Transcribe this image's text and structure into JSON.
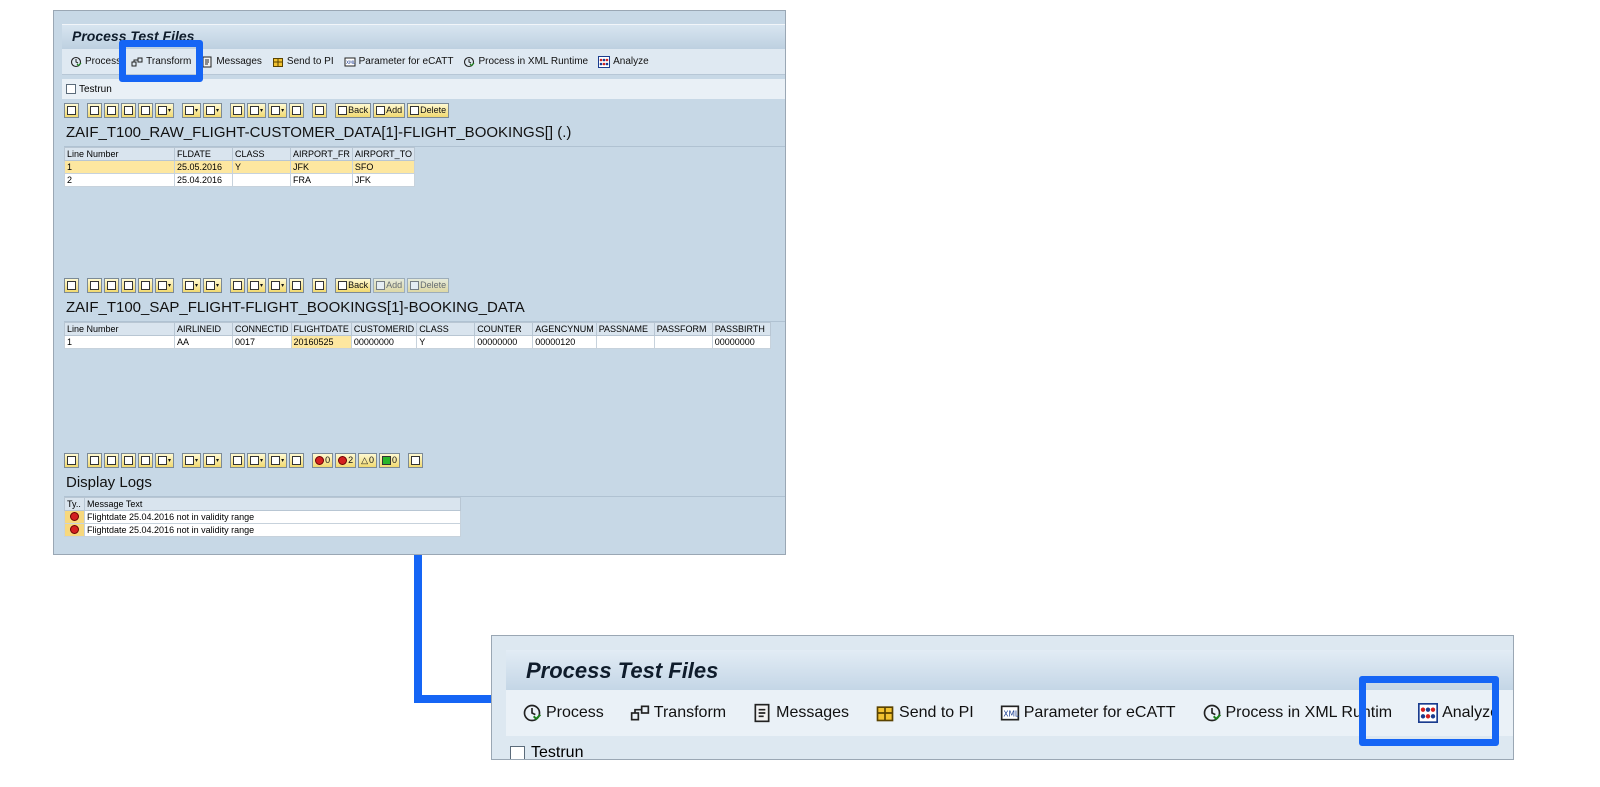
{
  "window": {
    "title": "Process Test Files"
  },
  "toolbar": {
    "items": [
      {
        "label": "Process",
        "icon": "clock-check-icon"
      },
      {
        "label": "Transform",
        "icon": "transform-icon"
      },
      {
        "label": "Messages",
        "icon": "messages-icon"
      },
      {
        "label": "Send to PI",
        "icon": "package-icon"
      },
      {
        "label": "Parameter for eCATT",
        "icon": "parameter-icon"
      },
      {
        "label": "Process in XML Runtime",
        "icon": "clock-check-icon"
      },
      {
        "label": "Analyze",
        "icon": "analyze-icon"
      }
    ]
  },
  "testrun": {
    "label": "Testrun",
    "checked": false
  },
  "grid1": {
    "toolbar": {
      "back": "Back",
      "add": "Add",
      "delete": "Delete"
    },
    "title": "ZAIF_T100_RAW_FLIGHT-CUSTOMER_DATA[1]-FLIGHT_BOOKINGS[] (.)",
    "columns": [
      "Line Number",
      "FLDATE",
      "CLASS",
      "AIRPORT_FR",
      "AIRPORT_TO"
    ],
    "rows": [
      [
        "1",
        "25.05.2016",
        "Y",
        "JFK",
        "SFO"
      ],
      [
        "2",
        "25.04.2016",
        "",
        "FRA",
        "JFK"
      ]
    ]
  },
  "grid2": {
    "toolbar": {
      "back": "Back",
      "add": "Add",
      "delete": "Delete"
    },
    "title": "ZAIF_T100_SAP_FLIGHT-FLIGHT_BOOKINGS[1]-BOOKING_DATA",
    "columns": [
      "Line Number",
      "AIRLINEID",
      "CONNECTID",
      "FLIGHTDATE",
      "CUSTOMERID",
      "CLASS",
      "COUNTER",
      "AGENCYNUM",
      "PASSNAME",
      "PASSFORM",
      "PASSBIRTH"
    ],
    "rows": [
      [
        "1",
        "AA",
        "0017",
        "20160525",
        "00000000",
        "Y",
        "00000000",
        "00000120",
        "",
        "",
        "00000000"
      ]
    ]
  },
  "logs": {
    "counts": {
      "error": "0",
      "warning_red": "2",
      "warning": "0",
      "success": "0"
    },
    "title": "Display Logs",
    "columns": [
      "Ty..",
      "Message Text"
    ],
    "rows": [
      {
        "type": "error",
        "text": "Flightdate 25.04.2016 not in validity range"
      },
      {
        "type": "error",
        "text": "Flightdate 25.04.2016 not in validity range"
      }
    ]
  },
  "zoom": {
    "title": "Process Test Files",
    "toolbar": {
      "items": [
        {
          "label": "Process"
        },
        {
          "label": "Transform"
        },
        {
          "label": "Messages"
        },
        {
          "label": "Send to PI"
        },
        {
          "label": "Parameter for eCATT"
        },
        {
          "label": "Process in XML Runtim"
        },
        {
          "label": "Analyze"
        }
      ]
    },
    "testrun": {
      "label": "Testrun"
    }
  },
  "colors": {
    "highlight": "#1565f5",
    "title_bg": "#c4d6e6",
    "selected_row": "#fde7a0"
  }
}
